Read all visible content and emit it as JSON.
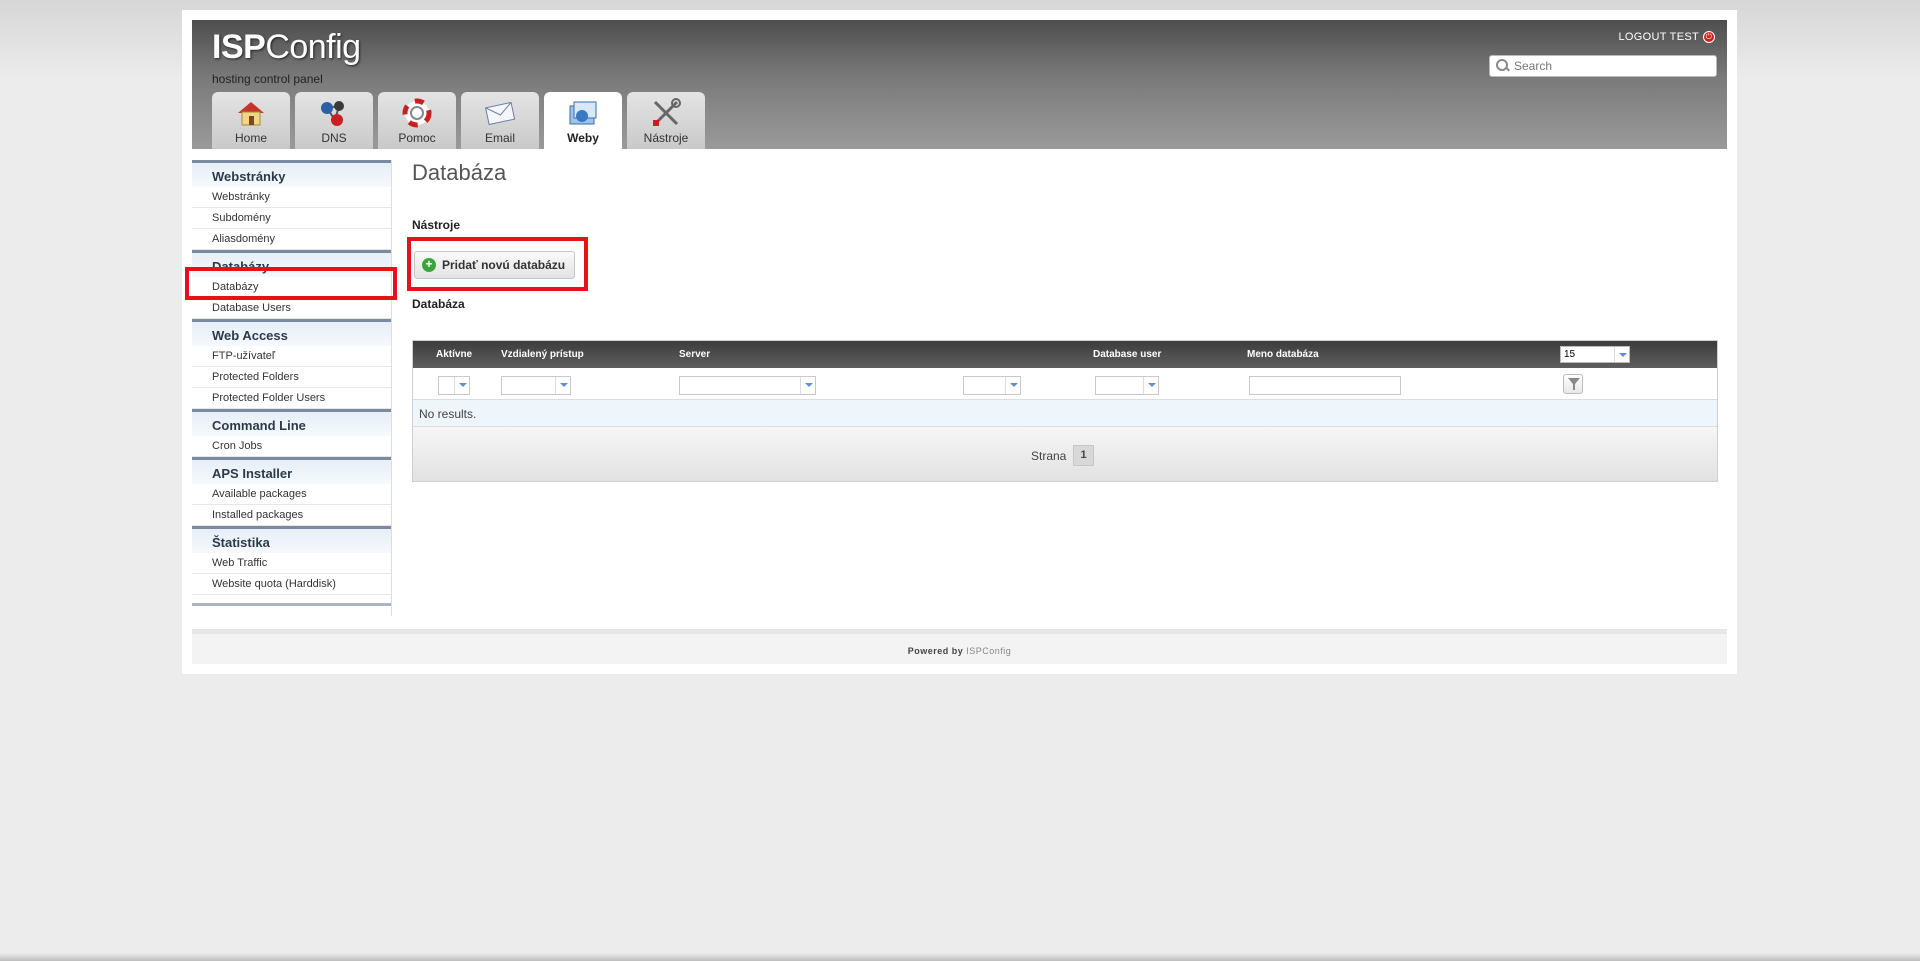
{
  "header": {
    "logo_bold": "ISP",
    "logo_rest": "Config",
    "tagline": "hosting control panel",
    "logout_label": "LOGOUT TEST",
    "search_placeholder": "Search"
  },
  "tabs": [
    {
      "label": "Home",
      "icon": "home-icon"
    },
    {
      "label": "DNS",
      "icon": "dns-icon"
    },
    {
      "label": "Pomoc",
      "icon": "help-icon"
    },
    {
      "label": "Email",
      "icon": "email-icon"
    },
    {
      "label": "Weby",
      "icon": "sites-icon",
      "active": true
    },
    {
      "label": "Nástroje",
      "icon": "tools-icon"
    }
  ],
  "sidebar": {
    "groups": [
      {
        "title": "Webstránky",
        "items": [
          "Webstránky",
          "Subdomény",
          "Aliasdomény"
        ]
      },
      {
        "title": "Databázy",
        "items": [
          "Databázy",
          "Database Users"
        ]
      },
      {
        "title": "Web Access",
        "items": [
          "FTP-užívateľ",
          "Protected Folders",
          "Protected Folder Users"
        ]
      },
      {
        "title": "Command Line",
        "items": [
          "Cron Jobs"
        ]
      },
      {
        "title": "APS Installer",
        "items": [
          "Available packages",
          "Installed packages"
        ]
      },
      {
        "title": "Štatistika",
        "items": [
          "Web Traffic",
          "Website quota (Harddisk)"
        ]
      }
    ]
  },
  "main": {
    "title": "Databáza",
    "tools_label": "Nástroje",
    "add_button": "Pridať novú databázu",
    "list_label": "Databáza",
    "columns": [
      "Aktívne",
      "Vzdialený prístup",
      "Server",
      "Database user",
      "Meno databáza"
    ],
    "per_page": "15",
    "no_results": "No results.",
    "pager_label": "Strana",
    "current_page": "1"
  },
  "footer": {
    "powered_by": "Powered by",
    "brand": "ISPConfig"
  },
  "colors": {
    "highlight": "#e8101a",
    "accent": "#5b8fd6"
  }
}
